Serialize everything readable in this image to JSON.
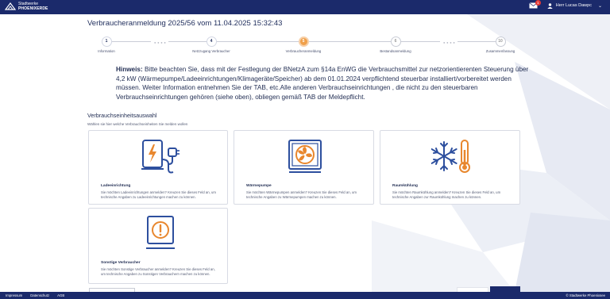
{
  "header": {
    "logo_line1": "Stadtwerke",
    "logo_line2": "PHOENIXERDE",
    "mail_badge": "1",
    "user_name": "Herr Lucas Dawpc"
  },
  "page": {
    "title": "Verbraucheranmeldung 2025/56 vom 11.04.2025 15:32:43"
  },
  "stepper": {
    "steps": [
      {
        "number": "1",
        "label": "Information",
        "state": "done"
      },
      {
        "number": "4",
        "label": "Netzzugang Verbraucher",
        "state": "done"
      },
      {
        "number": "5",
        "label": "Verbraucheranmeldung",
        "state": "active"
      },
      {
        "number": "6",
        "label": "Bestandsanmeldung",
        "state": "future"
      },
      {
        "number": "10",
        "label": "Zusammenfassung",
        "state": "future"
      }
    ]
  },
  "notice": {
    "label": "Hinweis:",
    "text": "Bitte beachten Sie, dass mit der Festlegung der BNetzA zum §14a EnWG die Verbrauchsmittel zur netzorientierenten Steuerung über 4,2 kW (Wärmepumpe/Ladeeinrichtungen/Klimageräte/Speicher) ab dem 01.01.2024 verpflichtend steuerbar installiert/vorbereitet werden müssen. Weiter Information entnehmen Sie der TAB, etc.Alle anderen Verbrauchseinrichtungen , die nicht zu den steuerbaren Verbrauchseinrichtungen gehören (siehe oben), obliegen gemäß TAB der Meldepflicht."
  },
  "selection": {
    "title": "Verbrauchseinheitsauswahl",
    "subtitle": "Wählen sie hier welche Verbrauchseinheiten Sie melden wollen",
    "cards": [
      {
        "title": "Ladeeinrichtung",
        "desc": "Sie möchten Ladeeinrichtungen anmelden? Kreuzen Sie dieses Feld an, um technische Angaben zu Ladeeinrichtungen machen zu können.",
        "icon": "ev-charger-icon"
      },
      {
        "title": "Wärmepumpe",
        "desc": "Sie möchten Wärmepumpen anmelden? Kreuzen Sie dieses Feld an, um technische Angaben zu Wärmepumpen machen zu können.",
        "icon": "heat-pump-icon"
      },
      {
        "title": "Raumkühlung",
        "desc": "Sie möchten Raumkühlung anmelden? Kreuzen Sie dieses Feld an, um technische Angaben zur Raumkühlung machen zu können.",
        "icon": "snowflake-thermometer-icon"
      },
      {
        "title": "Sonstige Verbraucher",
        "desc": "Sie möchten Sonstige Verbraucher anmelden? Kreuzen Sie dieses Feld an, um technische Angaben zu Sonstigen Verbrauchern machen zu können.",
        "icon": "exclamation-circle-icon"
      }
    ]
  },
  "footer": {
    "links": [
      "Impressum",
      "Datenschutz",
      "AGB"
    ],
    "copyright": "© Stadtwerke Phoenixsee"
  },
  "colors": {
    "navy": "#1b2a6b",
    "accent_orange": "#e8872e",
    "icon_blue": "#2d4f9e"
  }
}
